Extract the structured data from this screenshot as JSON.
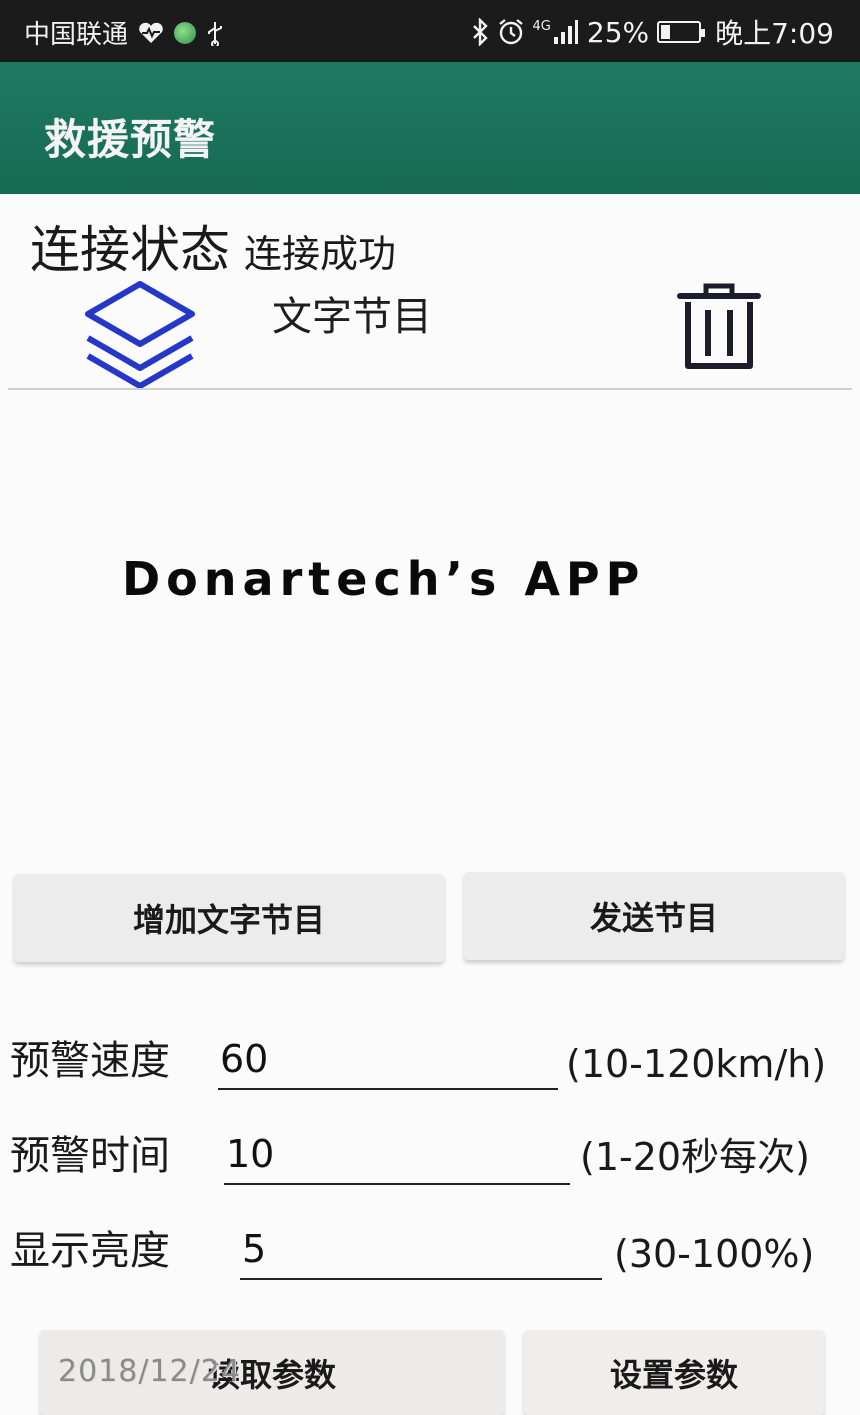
{
  "status_bar": {
    "carrier": "中国联通",
    "signal_type": "4G",
    "battery_percent": "25%",
    "battery_level": 0.25,
    "time": "晚上7:09",
    "icons": [
      "heart-monitor-icon",
      "globe-icon",
      "usb-icon",
      "bluetooth-icon",
      "alarm-icon",
      "signal-icon",
      "battery-icon"
    ]
  },
  "app_bar": {
    "title": "救援预警",
    "color": "#1f7a63"
  },
  "connection": {
    "label": "连接状态",
    "value": "连接成功"
  },
  "program": {
    "title": "文字节目",
    "left_icon": "layers-icon",
    "right_icon": "trash-icon",
    "accent": "#2437c8"
  },
  "preview": {
    "text": "Donartech’s APP"
  },
  "actions": {
    "add_program": "增加文字节目",
    "send_program": "发送节目"
  },
  "params": [
    {
      "label": "预警速度",
      "value": "60",
      "range": "(10-120km/h)"
    },
    {
      "label": "预警时间",
      "value": "10",
      "range": "(1-20秒每次)"
    },
    {
      "label": "显示亮度",
      "value": "5",
      "range": "(30-100%)"
    }
  ],
  "bottom_actions": {
    "read": "读取参数",
    "set": "设置参数"
  },
  "photo_timestamp": "2018/12/24"
}
